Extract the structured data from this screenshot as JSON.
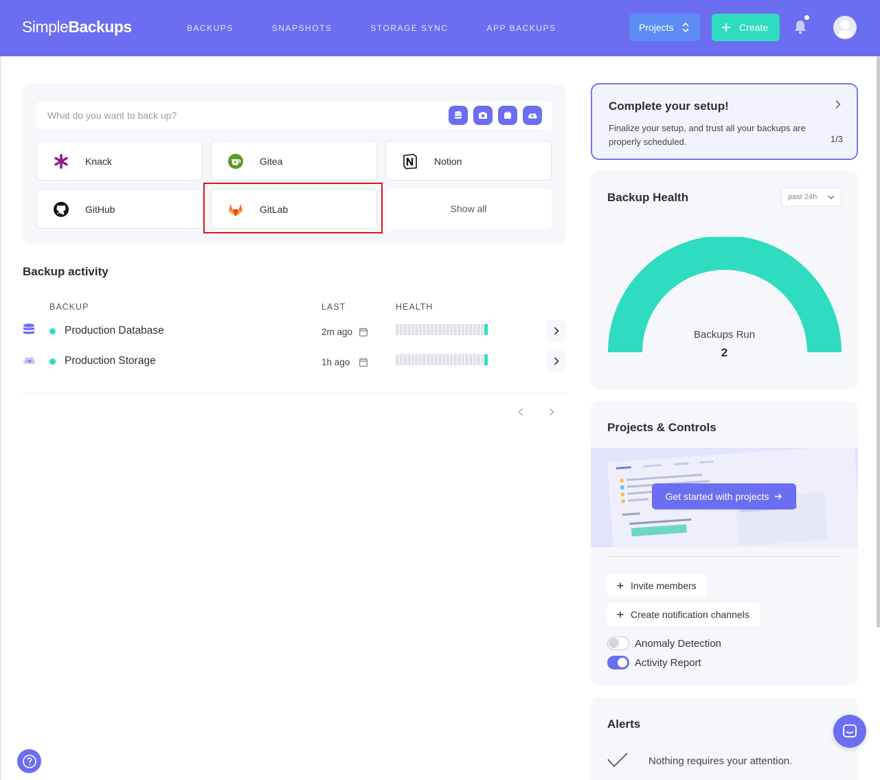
{
  "header": {
    "logo_light": "Simple",
    "logo_bold": "Backups",
    "nav": [
      "BACKUPS",
      "SNAPSHOTS",
      "STORAGE SYNC",
      "APP BACKUPS"
    ],
    "projects_label": "Projects",
    "create_label": "Create"
  },
  "backup_panel": {
    "search_placeholder": "What do you want to back up?",
    "type_icons": [
      "database-icon",
      "camera-icon",
      "app-box-icon",
      "cloud-icon"
    ],
    "services": [
      {
        "name": "Knack",
        "icon": "knack-icon"
      },
      {
        "name": "Gitea",
        "icon": "gitea-icon"
      },
      {
        "name": "Notion",
        "icon": "notion-icon"
      },
      {
        "name": "GitHub",
        "icon": "github-icon"
      },
      {
        "name": "GitLab",
        "icon": "gitlab-icon"
      }
    ],
    "show_all": "Show all"
  },
  "activity": {
    "title": "Backup activity",
    "columns": {
      "backup": "BACKUP",
      "last": "LAST",
      "health": "HEALTH"
    },
    "rows": [
      {
        "name": "Production Database",
        "last": "2m ago",
        "icon": "database-icon",
        "status_color": "#2fdcc0"
      },
      {
        "name": "Production Storage",
        "last": "1h ago",
        "icon": "cloud-storage-icon",
        "status_color": "#2fdcc0"
      }
    ]
  },
  "setup": {
    "title": "Complete your setup!",
    "description": "Finalize your setup, and trust all your backups are properly scheduled.",
    "progress": "1/3"
  },
  "health": {
    "title": "Backup Health",
    "range": "past 24h",
    "gauge_label": "Backups Run",
    "gauge_value": "2",
    "gauge_fraction": 1.0,
    "gauge_color": "#2fdcc0"
  },
  "projects": {
    "title": "Projects & Controls",
    "cta": "Get started with projects",
    "invite": "Invite members",
    "notify": "Create notification channels",
    "toggles": [
      {
        "label": "Anomaly Detection",
        "on": false
      },
      {
        "label": "Activity Report",
        "on": true
      }
    ]
  },
  "alerts": {
    "title": "Alerts",
    "message": "Nothing requires your attention."
  },
  "colors": {
    "accent": "#6b6ef0",
    "teal": "#2fdcc0"
  }
}
